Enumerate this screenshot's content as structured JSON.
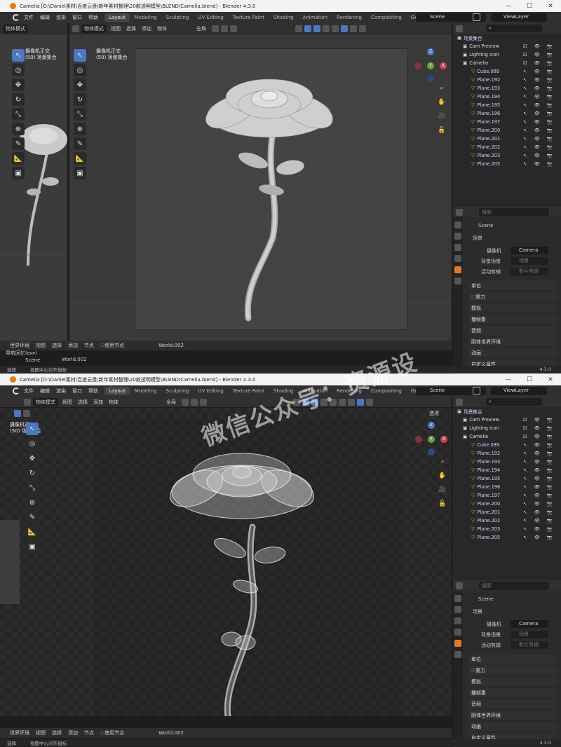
{
  "window": {
    "title": "Camelia [D:\\Daniel素材\\百度云盘\\新年素材整理\\20款透明模型\\BLEND\\Camelia.blend] - Blender 4.3.0",
    "minimize": "—",
    "maximize": "☐",
    "close": "✕"
  },
  "menu": {
    "items": [
      "文件",
      "编辑",
      "渲染",
      "窗口",
      "帮助"
    ],
    "tabs": [
      "Layout",
      "Modeling",
      "Sculpting",
      "UV Editing",
      "Texture Paint",
      "Shading",
      "Animation",
      "Rendering",
      "Compositing",
      "Geometry Nodes"
    ],
    "scene": "Scene",
    "view_layer": "ViewLayer"
  },
  "viewport_header": {
    "mode": "物体模式",
    "items": [
      "视图",
      "选择",
      "添加",
      "物体"
    ],
    "transform": "全局",
    "options": "选项"
  },
  "left_viewport": {
    "mode": "物体模式",
    "options": "选"
  },
  "viewport": {
    "overlay_line1": "摄像机正交",
    "overlay_line2": "(50) 场景集合"
  },
  "left_overlay": {
    "line1": "摄像机正交",
    "line2": "(50) 场景集合",
    "bottom_line1": "导航回忆(ᴇᴋᴘ)",
    "bottom_line2": "Scene",
    "bottom_line3": "World.002"
  },
  "outliner": {
    "root": "场景集合",
    "rows": [
      {
        "name": "Cam Preview",
        "level": 1,
        "icons": "☑ 👁 📷"
      },
      {
        "name": "Lighting Icon",
        "level": 1,
        "icons": "☑ 👁 📷"
      },
      {
        "name": "Camelia",
        "level": 1,
        "icons": "☑ 👁 📷"
      },
      {
        "name": "Cube.089",
        "level": 2,
        "icons": "↖ 👁 📷"
      },
      {
        "name": "Plane.192",
        "level": 2,
        "icons": "↖ 👁 📷"
      },
      {
        "name": "Plane.193",
        "level": 2,
        "icons": "↖ 👁 📷"
      },
      {
        "name": "Plane.194",
        "level": 2,
        "icons": "↖ 👁 📷"
      },
      {
        "name": "Plane.195",
        "level": 2,
        "icons": "↖ 👁 📷"
      },
      {
        "name": "Plane.196",
        "level": 2,
        "icons": "↖ 👁 📷"
      },
      {
        "name": "Plane.197",
        "level": 2,
        "icons": "↖ 👁 📷"
      },
      {
        "name": "Plane.200",
        "level": 2,
        "icons": "↖ 👁 📷"
      },
      {
        "name": "Plane.201",
        "level": 2,
        "icons": "↖ 👁 📷"
      },
      {
        "name": "Plane.202",
        "level": 2,
        "icons": "↖ 👁 📷"
      },
      {
        "name": "Plane.203",
        "level": 2,
        "icons": "↖ 👁 📷"
      },
      {
        "name": "Plane.205",
        "level": 2,
        "icons": "↖ 👁 📷"
      }
    ]
  },
  "properties": {
    "search_placeholder": "搜索",
    "scene_name": "Scene",
    "panel_title": "场景",
    "camera_label": "摄像机",
    "camera_value": "Camera",
    "background_label": "背景场景",
    "background_placeholder": "场景",
    "clip_label": "活动剪辑",
    "clip_placeholder": "影片剪辑",
    "sections": [
      "单位",
      "重力",
      "模拟",
      "播帧集",
      "音频",
      "刚体世界环境",
      "动画",
      "自定义属性"
    ]
  },
  "bottom_header": {
    "env": "世界环境",
    "items": [
      "视图",
      "选择",
      "添加",
      "节点"
    ],
    "use_nodes": "使用节点",
    "world": "World.002"
  },
  "status_bar": {
    "select": "选择",
    "center": "视图中心对齐鼠标",
    "version": "4.3.0"
  },
  "watermark": "微信公众号：资源设"
}
